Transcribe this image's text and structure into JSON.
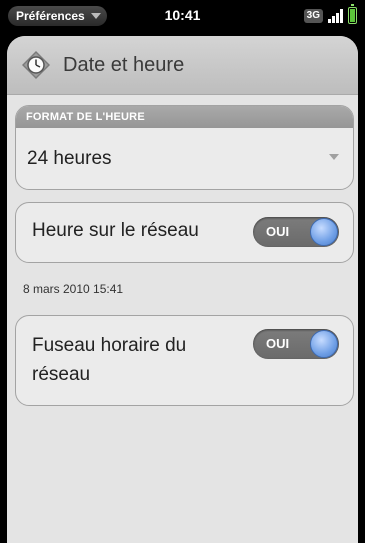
{
  "status_bar": {
    "app_menu_label": "Préférences",
    "time": "10:41",
    "network": "3G"
  },
  "header": {
    "icon": "clock-icon",
    "title": "Date et heure"
  },
  "time_format": {
    "section_label": "FORMAT DE L'HEURE",
    "selected": "24 heures"
  },
  "network_time": {
    "label": "Heure sur le réseau",
    "toggle_label": "OUI",
    "enabled": true
  },
  "current_datetime": "8 mars 2010 15:41",
  "network_timezone": {
    "label_line1": "Fuseau horaire du",
    "label_line2": "réseau",
    "toggle_label": "OUI",
    "enabled": true
  },
  "colors": {
    "toggle_on": "#6f9fe6",
    "battery": "#5cc63a"
  }
}
